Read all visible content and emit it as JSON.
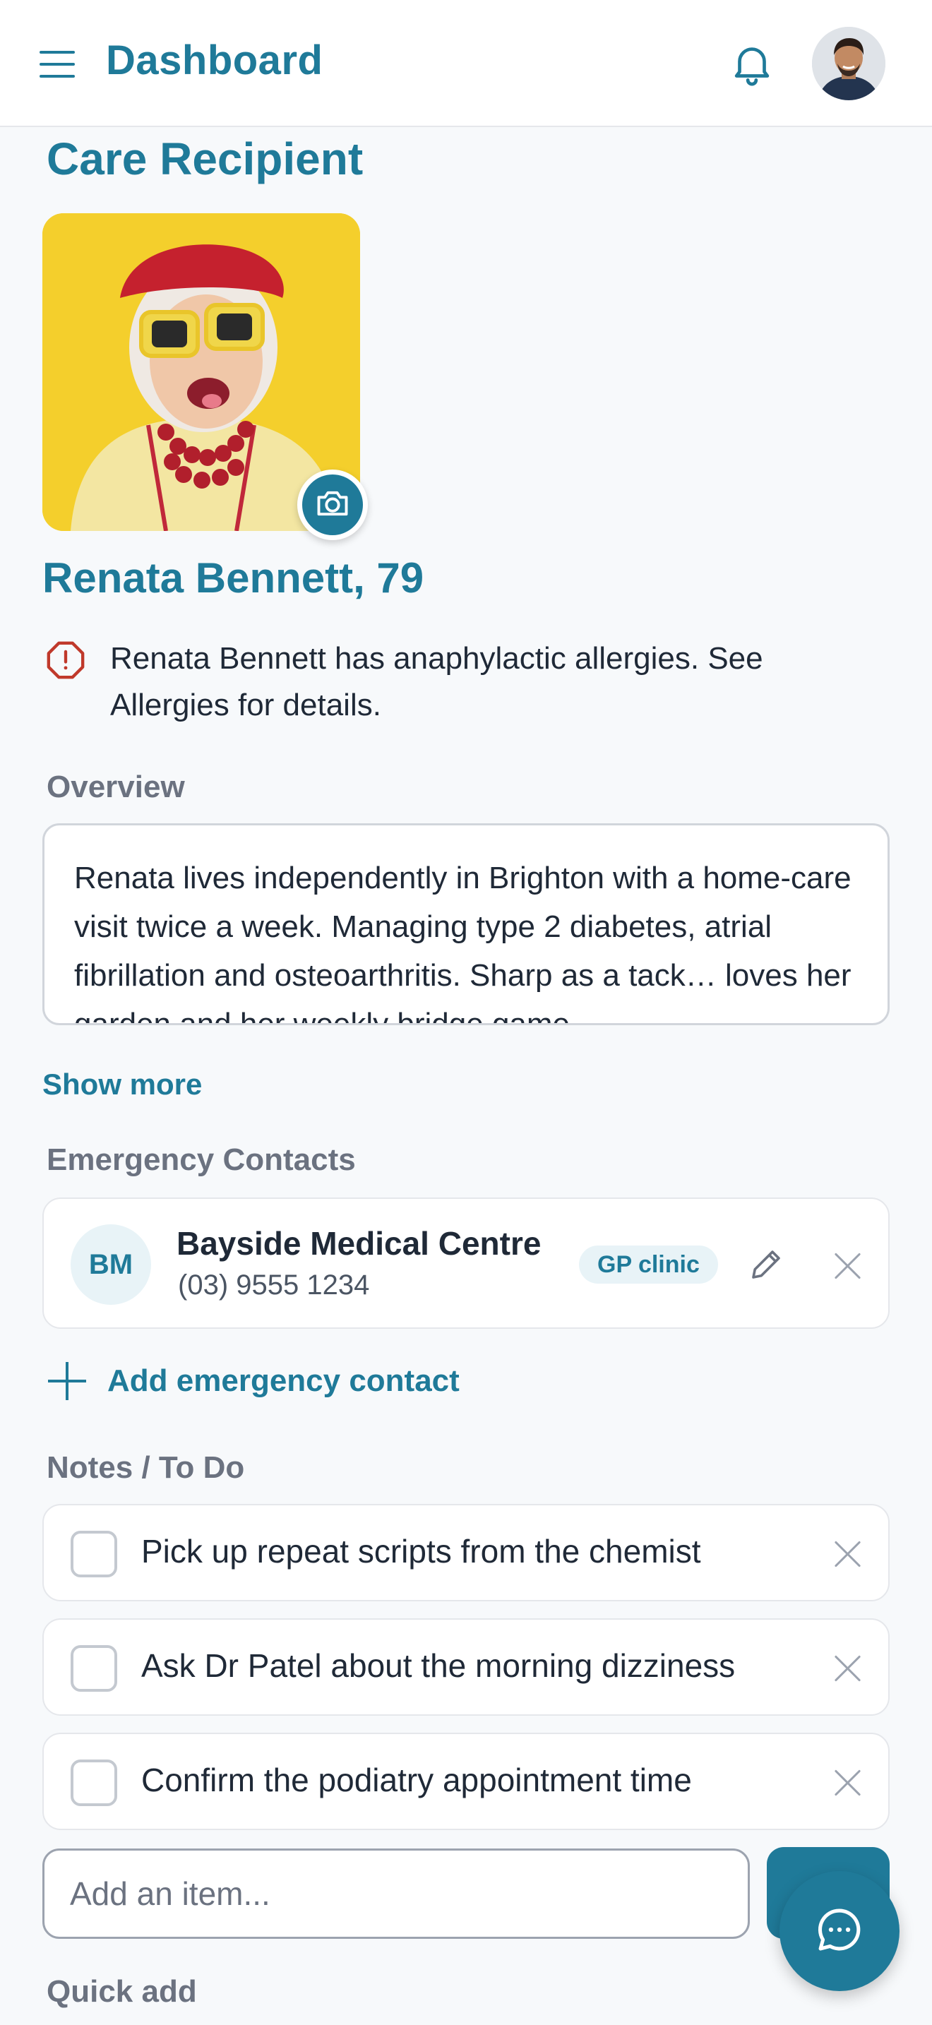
{
  "header": {
    "title": "Dashboard",
    "menu_icon": "menu-icon",
    "bell_icon": "bell-icon",
    "avatar": "user-avatar"
  },
  "care": {
    "section_title": "Care Recipient",
    "name_age": "Renata Bennett, 79",
    "photo": "care-recipient-photo",
    "camera_icon": "camera-icon",
    "alert_icon": "alert-icon",
    "alert_text": "Renata Bennett has anaphylactic allergies. See Allergies for details."
  },
  "overview": {
    "label": "Overview",
    "text": "Renata lives independently in Brighton with a home-care visit twice a week. Managing type 2 diabetes, atrial fibrillation and osteoarthritis. Sharp as a tack… loves her garden and her weekly bridge game.",
    "show_more": "Show more"
  },
  "emergency": {
    "label": "Emergency Contacts",
    "contacts": [
      {
        "initials": "BM",
        "name": "Bayside Medical Centre",
        "phone": "(03) 9555 1234",
        "tag": "GP clinic"
      }
    ],
    "add_label": "Add emergency contact"
  },
  "notes": {
    "label": "Notes / To Do",
    "items": [
      {
        "text": "Pick up repeat scripts from the chemist",
        "checked": false
      },
      {
        "text": "Ask Dr Patel about the morning dizziness",
        "checked": false
      },
      {
        "text": "Confirm the podiatry appointment time",
        "checked": false
      }
    ],
    "input_placeholder": "Add an item..."
  },
  "quick_add": {
    "label": "Quick add"
  },
  "colors": {
    "accent": "#1f7a99",
    "alert": "#c0392b",
    "muted": "#6b7280"
  }
}
